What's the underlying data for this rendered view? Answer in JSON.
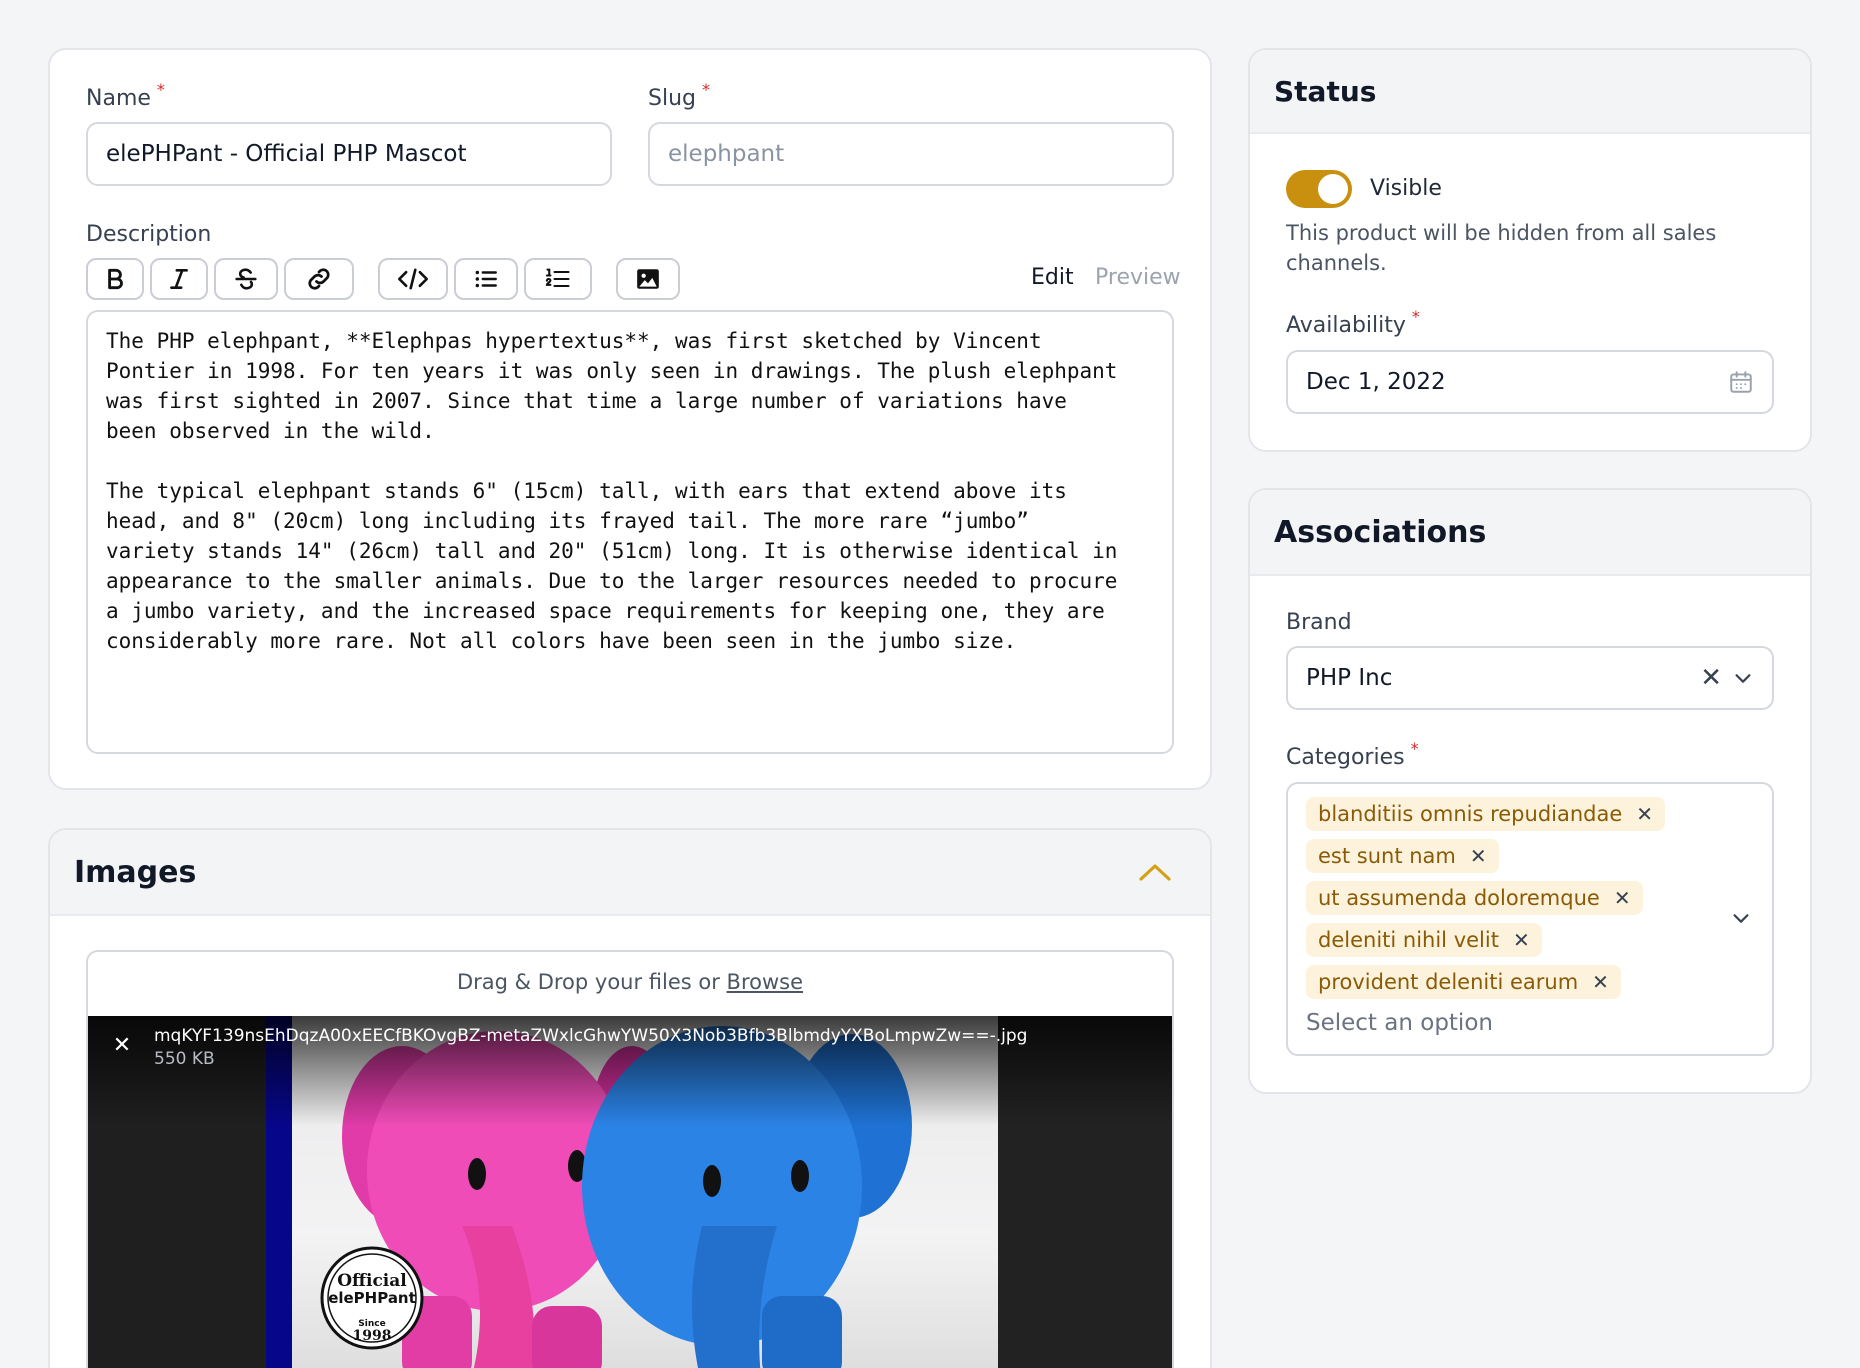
{
  "product": {
    "name_label": "Name",
    "name_value": "elePHPant - Official PHP Mascot",
    "slug_label": "Slug",
    "slug_value": "elephpant",
    "required_marker": "*",
    "description_label": "Description",
    "editor_tabs": {
      "edit": "Edit",
      "preview": "Preview"
    },
    "toolbar_icons": [
      "bold-icon",
      "italic-icon",
      "strikethrough-icon",
      "link-icon",
      "code-icon",
      "bullet-list-icon",
      "ordered-list-icon",
      "image-icon"
    ],
    "description_text": "The PHP elephpant, **Elephpas hypertextus**, was first sketched by Vincent\nPontier in 1998. For ten years it was only seen in drawings. The plush elephpant\nwas first sighted in 2007. Since that time a large number of variations have\nbeen observed in the wild.\n\nThe typical elephpant stands 6\" (15cm) tall, with ears that extend above its\nhead, and 8\" (20cm) long including its frayed tail. The more rare “jumbo”\nvariety stands 14\" (26cm) tall and 20\" (51cm) long. It is otherwise identical in\nappearance to the smaller animals. Due to the larger resources needed to procure\na jumbo variety, and the increased space requirements for keeping one, they are\nconsiderably more rare. Not all colors have been seen in the jumbo size."
  },
  "images": {
    "title": "Images",
    "drop_text": "Drag & Drop your files or ",
    "browse_link": "Browse",
    "file_name": "mqKYF139nsEhDqzA00xEECfBKOvgBZ-metaZWxlcGhwYW50X3Nob3Bfb3BlbmdyYXBoLmpwZw==-.jpg",
    "file_size": "550 KB",
    "badge_line1": "Official",
    "badge_line2": "elePHPant",
    "badge_line3": "Since",
    "badge_line4": "1998"
  },
  "status": {
    "title": "Status",
    "visible_label": "Visible",
    "visible_on": true,
    "hint": "This product will be hidden from all sales channels.",
    "availability_label": "Availability",
    "availability_value": "Dec 1, 2022"
  },
  "associations": {
    "title": "Associations",
    "brand_label": "Brand",
    "brand_value": "PHP Inc",
    "categories_label": "Categories",
    "categories": [
      "blanditiis omnis repudiandae",
      "est sunt nam",
      "ut assumenda doloremque",
      "deleniti nihil velit",
      "provident deleniti earum"
    ],
    "categories_placeholder": "Select an option"
  },
  "colors": {
    "accent": "#d4a017",
    "toggle_on": "#c8900e",
    "tag_bg": "#fdf3dc",
    "tag_text": "#8a5a06",
    "required": "#dc2626"
  }
}
